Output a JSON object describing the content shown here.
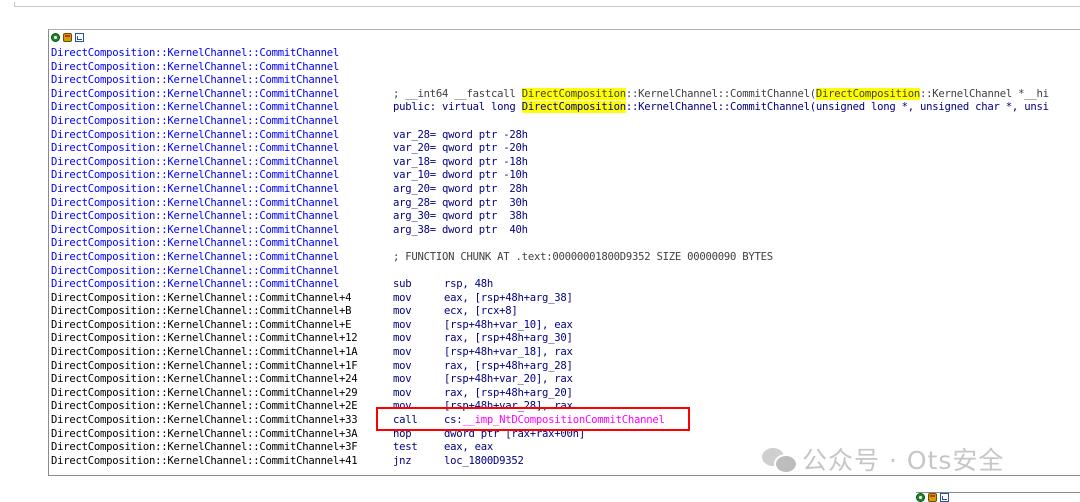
{
  "toolbar": {
    "icons": [
      "graph-view-icon",
      "hand-icon",
      "chart-icon"
    ]
  },
  "listing": {
    "rows": [
      {
        "addr": "DirectComposition::KernelChannel::CommitChannel",
        "color": "blue"
      },
      {
        "addr": "DirectComposition::KernelChannel::CommitChannel",
        "color": "blue"
      },
      {
        "addr": "DirectComposition::KernelChannel::CommitChannel",
        "color": "blue"
      },
      {
        "addr": "DirectComposition::KernelChannel::CommitChannel",
        "color": "blue",
        "kind": "comment_sig",
        "parts": [
          "; __int64 __fastcall ",
          "DirectComposition",
          "::KernelChannel::CommitChannel(",
          "DirectComposition",
          "::KernelChannel *__hi"
        ]
      },
      {
        "addr": "DirectComposition::KernelChannel::CommitChannel",
        "color": "blue",
        "kind": "decl",
        "parts": [
          "public: virtual long ",
          "DirectComposition",
          "::KernelChannel::CommitChannel(unsigned long *, unsigned char *, unsi"
        ]
      },
      {
        "addr": "DirectComposition::KernelChannel::CommitChannel",
        "color": "blue"
      },
      {
        "addr": "DirectComposition::KernelChannel::CommitChannel",
        "color": "blue",
        "kind": "var",
        "text": "var_28= qword ptr -28h"
      },
      {
        "addr": "DirectComposition::KernelChannel::CommitChannel",
        "color": "blue",
        "kind": "var",
        "text": "var_20= qword ptr -20h"
      },
      {
        "addr": "DirectComposition::KernelChannel::CommitChannel",
        "color": "blue",
        "kind": "var",
        "text": "var_18= qword ptr -18h"
      },
      {
        "addr": "DirectComposition::KernelChannel::CommitChannel",
        "color": "blue",
        "kind": "var",
        "text": "var_10= dword ptr -10h"
      },
      {
        "addr": "DirectComposition::KernelChannel::CommitChannel",
        "color": "blue",
        "kind": "var",
        "text": "arg_20= qword ptr  28h"
      },
      {
        "addr": "DirectComposition::KernelChannel::CommitChannel",
        "color": "blue",
        "kind": "var",
        "text": "arg_28= qword ptr  30h"
      },
      {
        "addr": "DirectComposition::KernelChannel::CommitChannel",
        "color": "blue",
        "kind": "var",
        "text": "arg_30= qword ptr  38h"
      },
      {
        "addr": "DirectComposition::KernelChannel::CommitChannel",
        "color": "blue",
        "kind": "var",
        "text": "arg_38= dword ptr  40h"
      },
      {
        "addr": "DirectComposition::KernelChannel::CommitChannel",
        "color": "blue"
      },
      {
        "addr": "DirectComposition::KernelChannel::CommitChannel",
        "color": "blue",
        "kind": "comment",
        "text": "; FUNCTION CHUNK AT .text:00000001800D9352 SIZE 00000090 BYTES"
      },
      {
        "addr": "DirectComposition::KernelChannel::CommitChannel",
        "color": "blue"
      },
      {
        "addr": "DirectComposition::KernelChannel::CommitChannel",
        "color": "blue",
        "kind": "ins",
        "mn": "sub",
        "op": "rsp, 48h"
      },
      {
        "addr": "DirectComposition::KernelChannel::CommitChannel+4",
        "color": "black",
        "kind": "ins",
        "mn": "mov",
        "op": "eax, [rsp+48h+arg_38]"
      },
      {
        "addr": "DirectComposition::KernelChannel::CommitChannel+B",
        "color": "black",
        "kind": "ins",
        "mn": "mov",
        "op": "ecx, [rcx+8]"
      },
      {
        "addr": "DirectComposition::KernelChannel::CommitChannel+E",
        "color": "black",
        "kind": "ins",
        "mn": "mov",
        "op": "[rsp+48h+var_10], eax"
      },
      {
        "addr": "DirectComposition::KernelChannel::CommitChannel+12",
        "color": "black",
        "kind": "ins",
        "mn": "mov",
        "op": "rax, [rsp+48h+arg_30]"
      },
      {
        "addr": "DirectComposition::KernelChannel::CommitChannel+1A",
        "color": "black",
        "kind": "ins",
        "mn": "mov",
        "op": "[rsp+48h+var_18], rax"
      },
      {
        "addr": "DirectComposition::KernelChannel::CommitChannel+1F",
        "color": "black",
        "kind": "ins",
        "mn": "mov",
        "op": "rax, [rsp+48h+arg_28]"
      },
      {
        "addr": "DirectComposition::KernelChannel::CommitChannel+24",
        "color": "black",
        "kind": "ins",
        "mn": "mov",
        "op": "[rsp+48h+var_20], rax"
      },
      {
        "addr": "DirectComposition::KernelChannel::CommitChannel+29",
        "color": "black",
        "kind": "ins",
        "mn": "mov",
        "op": "rax, [rsp+48h+arg_20]"
      },
      {
        "addr": "DirectComposition::KernelChannel::CommitChannel+2E",
        "color": "black",
        "kind": "ins",
        "mn": "mov",
        "op": "[rsp+48h+var_28], rax"
      },
      {
        "addr": "DirectComposition::KernelChannel::CommitChannel+33",
        "color": "black",
        "kind": "call",
        "mn": "call",
        "op_prefix": "cs:",
        "op": "__imp_NtDCompositionCommitChannel"
      },
      {
        "addr": "DirectComposition::KernelChannel::CommitChannel+3A",
        "color": "black",
        "kind": "ins",
        "mn": "nop",
        "op": "dword ptr [rax+rax+00h]"
      },
      {
        "addr": "DirectComposition::KernelChannel::CommitChannel+3F",
        "color": "black",
        "kind": "ins",
        "mn": "test",
        "op": "eax, eax"
      },
      {
        "addr": "DirectComposition::KernelChannel::CommitChannel+41",
        "color": "black",
        "kind": "ins",
        "mn": "jnz",
        "op": "loc_1800D9352"
      }
    ]
  },
  "watermark": {
    "text": "公众号 · Ots安全"
  },
  "colors": {
    "address_blue": "#0000ff",
    "highlight": "#ffff00",
    "import": "#ff00ff",
    "annotation_box": "#ff0000"
  }
}
